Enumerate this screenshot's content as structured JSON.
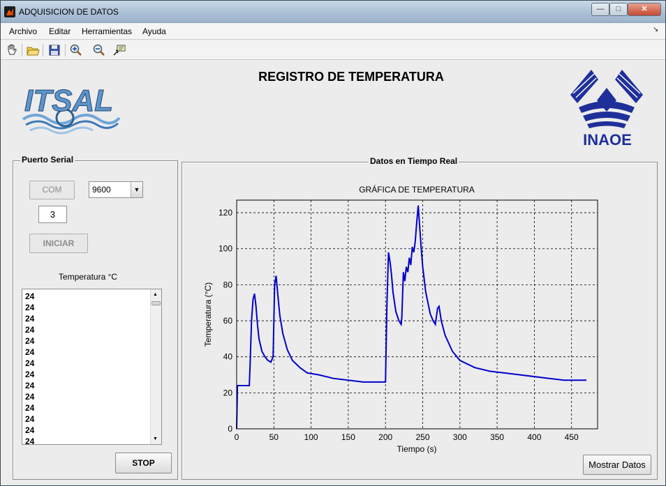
{
  "window": {
    "title": "ADQUISICION DE DATOS"
  },
  "menu": [
    "Archivo",
    "Editar",
    "Herramientas",
    "Ayuda"
  ],
  "toolbar_icons": [
    "pan-hand-icon",
    "open-folder-icon",
    "save-icon",
    "zoom-in-icon",
    "zoom-out-icon",
    "data-cursor-icon"
  ],
  "page": {
    "title": "REGISTRO DE TEMPERATURA"
  },
  "logos": {
    "left": "ITSAL",
    "right": "INAOE"
  },
  "serial_panel": {
    "legend": "Puerto Serial",
    "com_button": "COM",
    "baud_select": "9600",
    "port_number": "3",
    "start_button": "INICIAR",
    "temp_label": "Temperatura °C",
    "readings": [
      "24",
      "24",
      "24",
      "24",
      "24",
      "24",
      "24",
      "24",
      "24",
      "24",
      "24",
      "24",
      "24",
      "24"
    ],
    "stop_button": "STOP"
  },
  "realtime_panel": {
    "legend": "Datos en Tiempo Real",
    "show_button": "Mostrar Datos"
  },
  "chart_data": {
    "type": "line",
    "title": "GRÁFICA DE TEMPERATURA",
    "xlabel": "Tiempo (s)",
    "ylabel": "Temperatura (°C)",
    "xlim": [
      0,
      485
    ],
    "ylim": [
      0,
      127
    ],
    "xticks": [
      0,
      50,
      100,
      150,
      200,
      250,
      300,
      350,
      400,
      450
    ],
    "yticks": [
      0,
      20,
      40,
      60,
      80,
      100,
      120
    ],
    "grid": true,
    "color": "#0000cc",
    "x": [
      0,
      1,
      2,
      17,
      18,
      20,
      22,
      24,
      26,
      28,
      30,
      34,
      38,
      42,
      46,
      49,
      51,
      53,
      55,
      58,
      62,
      68,
      75,
      85,
      95,
      110,
      130,
      150,
      170,
      190,
      200,
      202,
      204,
      206,
      208,
      210,
      214,
      218,
      221,
      222,
      224,
      226,
      228,
      230,
      232,
      234,
      236,
      238,
      240,
      242,
      244,
      246,
      248,
      250,
      254,
      260,
      264,
      267,
      270,
      272,
      275,
      280,
      290,
      300,
      320,
      340,
      360,
      380,
      400,
      420,
      440,
      470
    ],
    "y": [
      0,
      24,
      24,
      24,
      35,
      60,
      72,
      75,
      68,
      58,
      50,
      43,
      40,
      38,
      37,
      40,
      80,
      85,
      76,
      63,
      53,
      44,
      38,
      34,
      31,
      30,
      28,
      27,
      26,
      26,
      26,
      70,
      98,
      93,
      86,
      76,
      65,
      60,
      58,
      62,
      87,
      82,
      90,
      87,
      95,
      91,
      101,
      98,
      104,
      115,
      124,
      112,
      100,
      90,
      76,
      64,
      60,
      58,
      67,
      68,
      60,
      52,
      43,
      38,
      34,
      32,
      31,
      30,
      29,
      28,
      27,
      27
    ]
  }
}
